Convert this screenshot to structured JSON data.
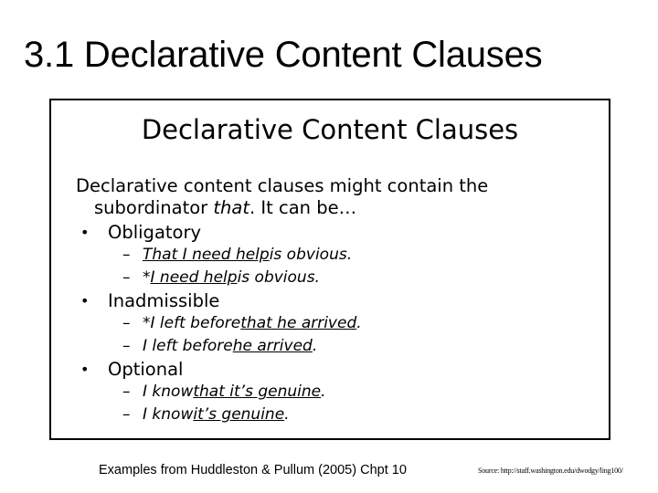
{
  "slide": {
    "title": "3.1 Declarative Content Clauses"
  },
  "figure": {
    "title": "Declarative Content Clauses",
    "intro_line1": "Declarative content clauses might contain the",
    "intro_line2_pre": "subordinator ",
    "intro_line2_em": "that",
    "intro_line2_post": ". It can be…",
    "groups": [
      {
        "label": "Obligatory",
        "examples": [
          {
            "pre": "",
            "underlined": "That I need help",
            "post": " is obvious."
          },
          {
            "pre": "*",
            "underlined": "I need help",
            "post": " is obvious."
          }
        ]
      },
      {
        "label": "Inadmissible",
        "examples": [
          {
            "pre": "*I left before ",
            "underlined": "that he arrived",
            "post": "."
          },
          {
            "pre": "I left before ",
            "underlined": "he arrived",
            "post": "."
          }
        ]
      },
      {
        "label": "Optional",
        "examples": [
          {
            "pre": "I know ",
            "underlined": "that it’s genuine",
            "post": "."
          },
          {
            "pre": "I know ",
            "underlined": "it’s genuine",
            "post": "."
          }
        ]
      }
    ],
    "bullet_glyph": "•",
    "dash_glyph": "–"
  },
  "footer": {
    "citation": "Examples from Huddleston & Pullum (2005) Chpt 10",
    "source": "Source: http://staff.washington.edu/dwodgy/ling100/"
  }
}
